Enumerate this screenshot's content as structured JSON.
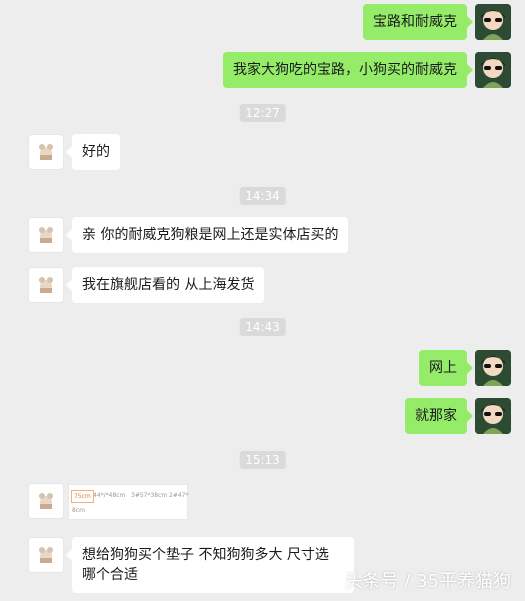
{
  "messages": [
    {
      "text": "宝路和耐威克"
    },
    {
      "text": "我家大狗吃的宝路，小狗买的耐威克"
    },
    {
      "text": "好的"
    },
    {
      "text": "亲  你的耐威克狗粮是网上还是实体店买的"
    },
    {
      "text": "我在旗舰店看的    从上海发货"
    },
    {
      "text": "网上"
    },
    {
      "text": "就那家"
    },
    {
      "text": "想给狗狗买个垫子   不知狗狗多大   尺寸选"
    },
    {
      "text": "哪个合适"
    }
  ],
  "times": [
    "12:27",
    "14:34",
    "14:43",
    "15:13"
  ],
  "image_message": {
    "cells": [
      "75cm",
      "44*/*48cm",
      "3#57*38cm",
      "2#47*"
    ],
    "bottom": "8cm"
  },
  "watermark": "头条号 / 35平养猫狗"
}
